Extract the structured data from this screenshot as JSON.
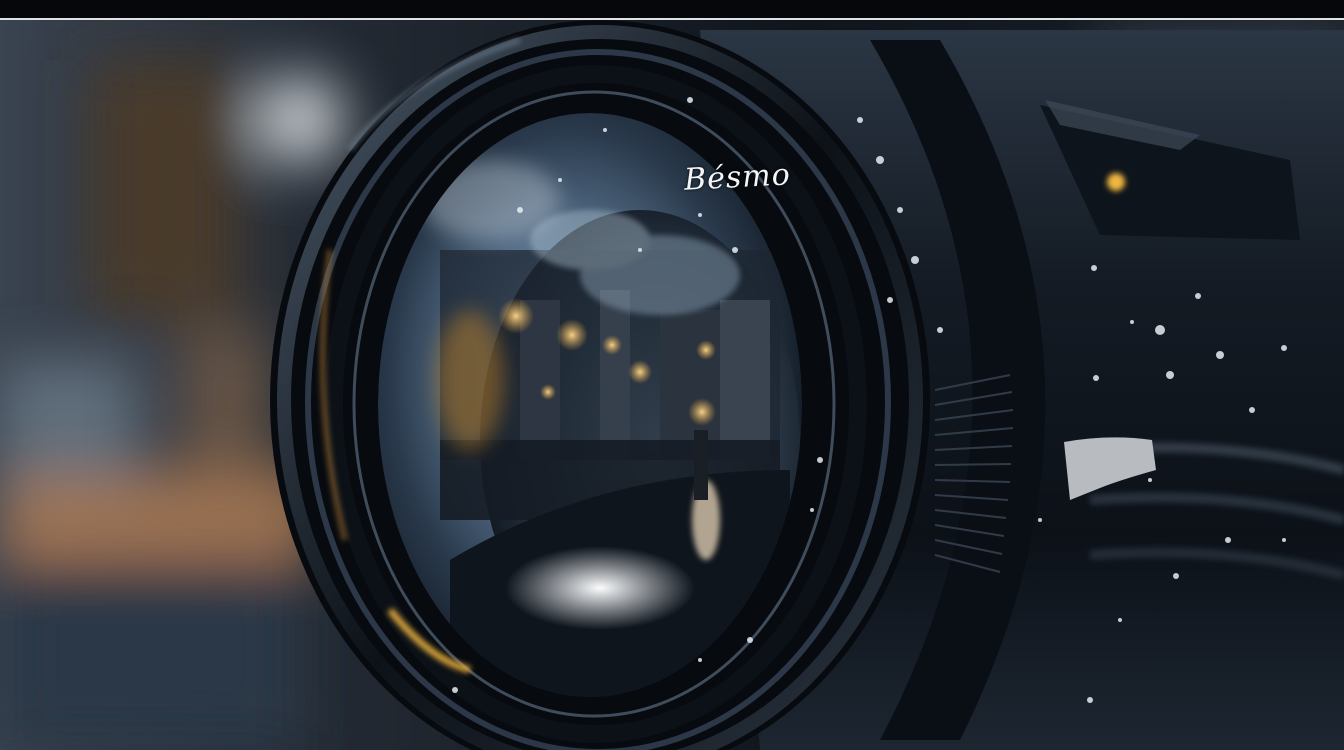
{
  "image": {
    "subject": "camera-lens-closeup",
    "lens_marking": "Bésmo",
    "lens_sub_marking": "",
    "colors": {
      "background_dark": "#0a0e14",
      "lens_body": "#141a22",
      "glass_blue": "#5d7894",
      "warm_light": "#e8a642",
      "highlight": "#eef2f6",
      "top_rule": "#dfe3e8"
    }
  }
}
